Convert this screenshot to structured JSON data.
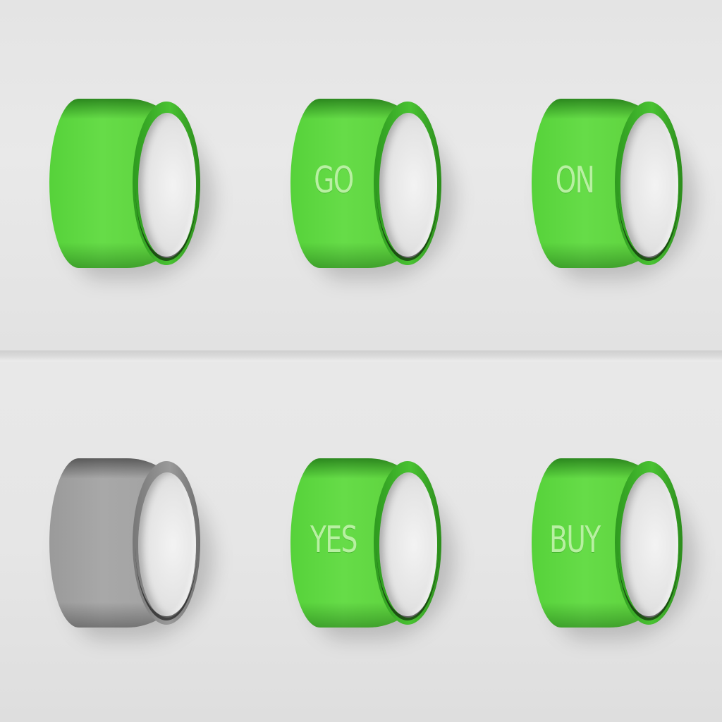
{
  "toggles": [
    {
      "id": "t1",
      "state": "on",
      "label": ""
    },
    {
      "id": "t2",
      "state": "on",
      "label": "GO"
    },
    {
      "id": "t3",
      "state": "on",
      "label": "ON"
    },
    {
      "id": "t4",
      "state": "off",
      "label": ""
    },
    {
      "id": "t5",
      "state": "on",
      "label": "YES"
    },
    {
      "id": "t6",
      "state": "on",
      "label": "BUY"
    }
  ],
  "colors": {
    "on_green": "#5fd43f",
    "off_gray": "#a3a3a3",
    "label_text": "#b8f0a2",
    "knob": "#e4e4e4",
    "background": "#e6e6e6"
  }
}
